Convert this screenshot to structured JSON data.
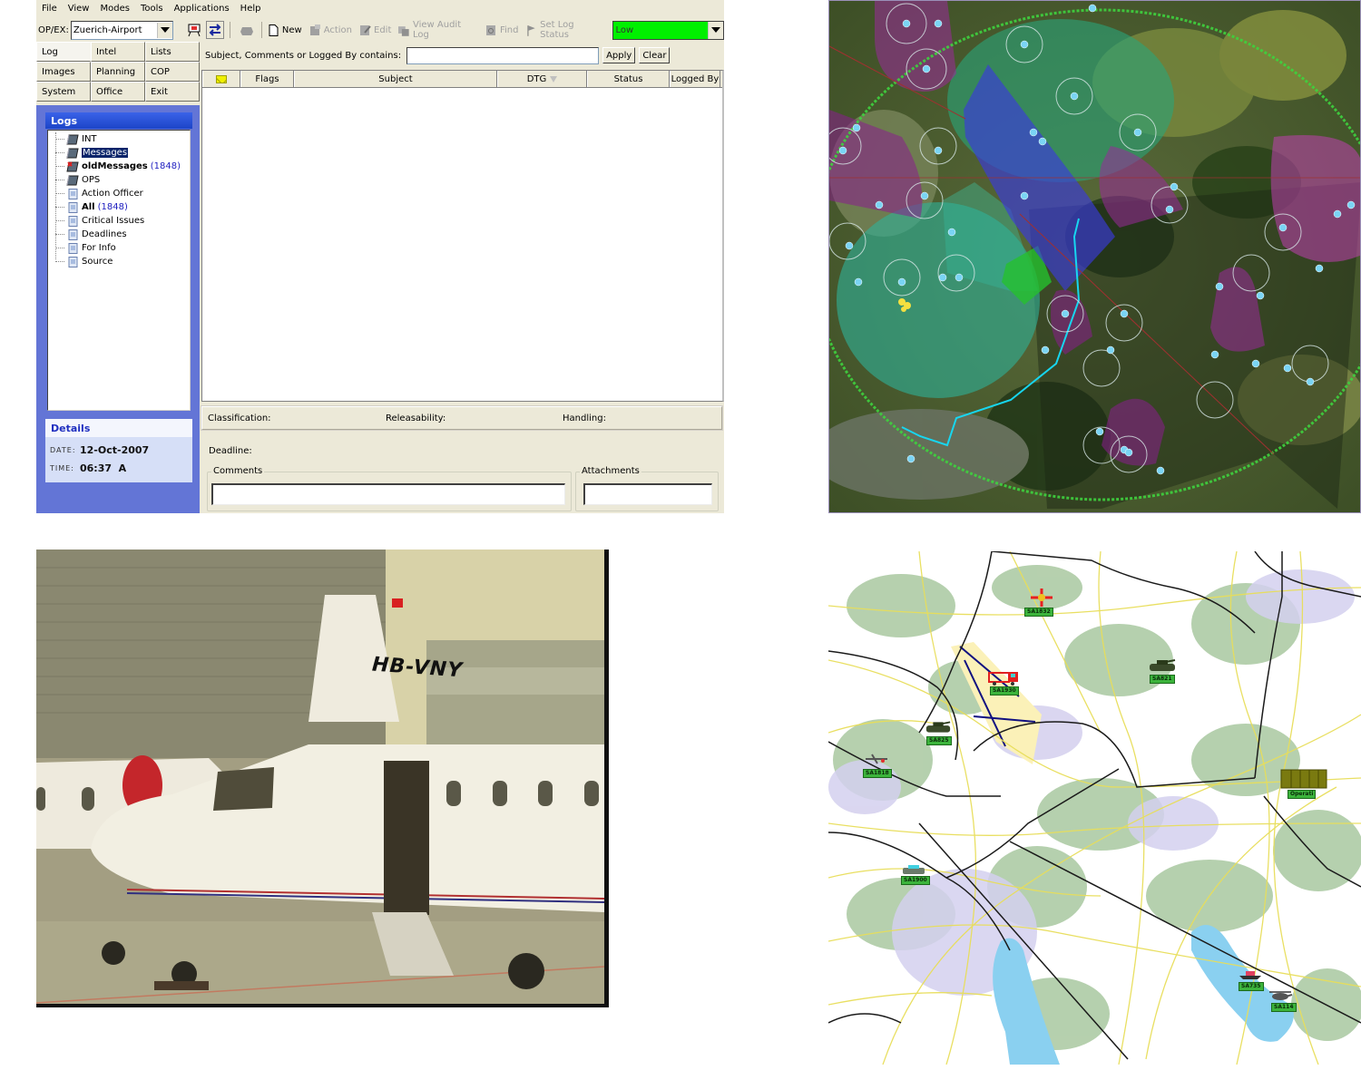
{
  "app": {
    "menu": [
      "File",
      "View",
      "Modes",
      "Tools",
      "Applications",
      "Help"
    ],
    "opex_label": "OP/EX:",
    "opex_value": "Zuerich-Airport",
    "toolbar": {
      "new": "New",
      "action": "Action",
      "edit": "Edit",
      "view_audit_log": "View Audit Log",
      "find": "Find",
      "set_log_status": "Set Log Status"
    },
    "status_select": {
      "value": "Low",
      "color": "#00f000"
    },
    "nav": [
      [
        "Log",
        "Intel",
        "Lists"
      ],
      [
        "Images",
        "Planning",
        "COP"
      ],
      [
        "System",
        "Office",
        "Exit"
      ]
    ],
    "filter": {
      "label": "Subject, Comments or Logged By contains:",
      "value": "",
      "apply": "Apply",
      "clear": "Clear"
    },
    "grid_columns": [
      "",
      "Flags",
      "Subject",
      "DTG",
      "Status",
      "Logged By"
    ],
    "logs": {
      "title": "Logs",
      "items": [
        {
          "label": "INT",
          "icon": "log-book-icon",
          "count": ""
        },
        {
          "label": "Messages",
          "icon": "log-book-icon",
          "count": "",
          "selected": true
        },
        {
          "label": "oldMessages",
          "icon": "log-book-flagged-icon",
          "count": "(1848)",
          "bold": true
        },
        {
          "label": "OPS",
          "icon": "log-book-icon",
          "count": ""
        },
        {
          "label": "Action Officer",
          "icon": "filter-page-icon",
          "count": ""
        },
        {
          "label": "All",
          "icon": "filter-page-icon",
          "count": "(1848)",
          "bold": true
        },
        {
          "label": "Critical Issues",
          "icon": "filter-page-icon",
          "count": ""
        },
        {
          "label": "Deadlines",
          "icon": "filter-page-icon",
          "count": ""
        },
        {
          "label": "For Info",
          "icon": "filter-page-icon",
          "count": ""
        },
        {
          "label": "Source",
          "icon": "filter-page-icon",
          "count": ""
        }
      ]
    },
    "details": {
      "title": "Details",
      "date_label": "DATE:",
      "date_value": "12-Oct-2007",
      "time_label": "TIME:",
      "time_value": "06:37  A"
    },
    "record": {
      "classification": "Classification:",
      "releasability": "Releasability:",
      "handling": "Handling:",
      "deadline": "Deadline:",
      "comments": "Comments",
      "attachments": "Attachments"
    }
  },
  "photo": {
    "tail_registration": "HB-VNY"
  },
  "vector_map": {
    "units": [
      {
        "label": "SA1832",
        "type": "aircraft-symbol"
      },
      {
        "label": "SA1930",
        "type": "fire-truck"
      },
      {
        "label": "SA821",
        "type": "tank"
      },
      {
        "label": "SA825",
        "type": "tank"
      },
      {
        "label": "SA1818",
        "type": "drone"
      },
      {
        "label": "SA1900",
        "type": "vehicle"
      },
      {
        "label": "Operati",
        "type": "command-post"
      },
      {
        "label": "SA735",
        "type": "boat"
      },
      {
        "label": "SA114",
        "type": "helicopter"
      }
    ]
  }
}
